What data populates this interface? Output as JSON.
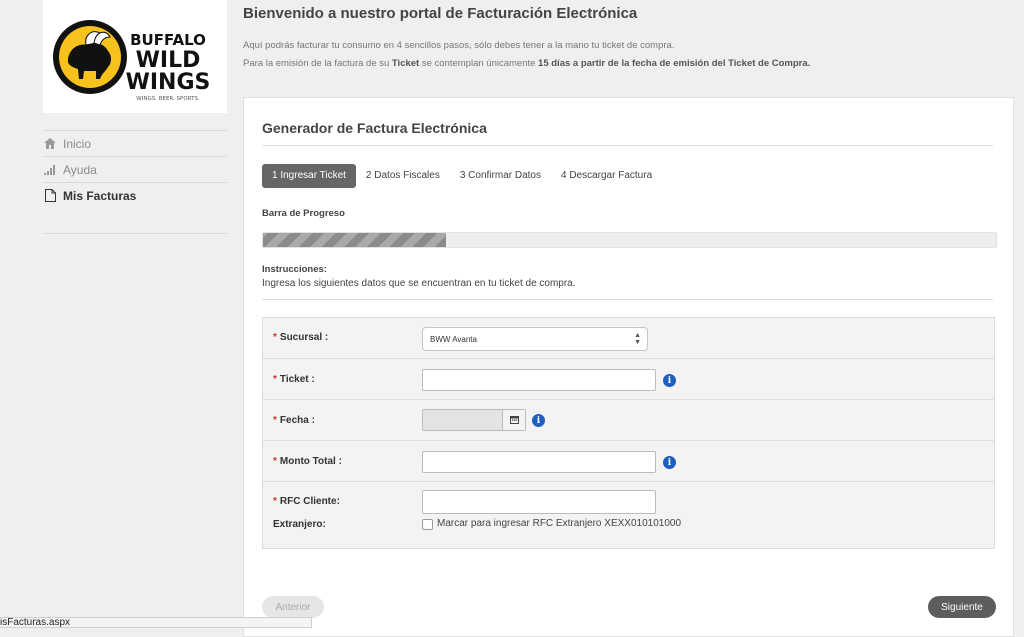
{
  "brand": {
    "logo_lines": [
      "BUFFALO",
      "WILD",
      "WINGS"
    ],
    "tagline": "WINGS. BEER. SPORTS.",
    "colors": {
      "yellow": "#f7c21b",
      "black": "#111111"
    }
  },
  "sidebar": {
    "items": [
      {
        "label": "Inicio",
        "icon": "home-icon"
      },
      {
        "label": "Ayuda",
        "icon": "signal-bars-icon"
      },
      {
        "label": "Mis Facturas",
        "icon": "document-icon",
        "active": true
      }
    ]
  },
  "header": {
    "title": "Bienvenido a nuestro portal de Facturación Electrónica",
    "line1": "Aquí podrás facturar tu consumo en 4 sencillos pasos, sólo debes tener a la mano tu ticket de compra.",
    "line2_pre": "Para la emisión de la factura de su ",
    "line2_b1": "Ticket",
    "line2_mid": " se contemplan únicamente ",
    "line2_b2": "15 días a partir de la fecha de emisión del Ticket de Compra."
  },
  "card": {
    "title": "Generador de Factura Electrónica",
    "steps": [
      {
        "label": "1 Ingresar Ticket",
        "active": true
      },
      {
        "label": "2 Datos Fiscales"
      },
      {
        "label": "3 Confirmar Datos"
      },
      {
        "label": "4 Descargar Factura"
      }
    ],
    "progress_label": "Barra de Progreso",
    "progress_fraction": 0.25,
    "instructions_label": "Instrucciones:",
    "instructions_text": "Ingresa los siguientes datos que se encuentran en tu ticket de compra."
  },
  "form": {
    "required_mark": "*",
    "sucursal_label": "Sucursal :",
    "sucursal_value": "BWW Avanta",
    "ticket_label": "Ticket :",
    "ticket_value": "",
    "fecha_label": "Fecha :",
    "fecha_value": "",
    "monto_label": "Monto Total :",
    "monto_value": "",
    "rfc_label": "RFC Cliente:",
    "rfc_value": "",
    "extranjero_label": "Extranjero:",
    "extranjero_checkbox_label": "Marcar para ingresar RFC Extranjero XEXX010101000",
    "extranjero_checked": false,
    "info_glyph": "i"
  },
  "buttons": {
    "prev_label": "Anterior",
    "next_label": "Siguiente"
  },
  "status_bar": {
    "text": "isFacturas.aspx"
  }
}
